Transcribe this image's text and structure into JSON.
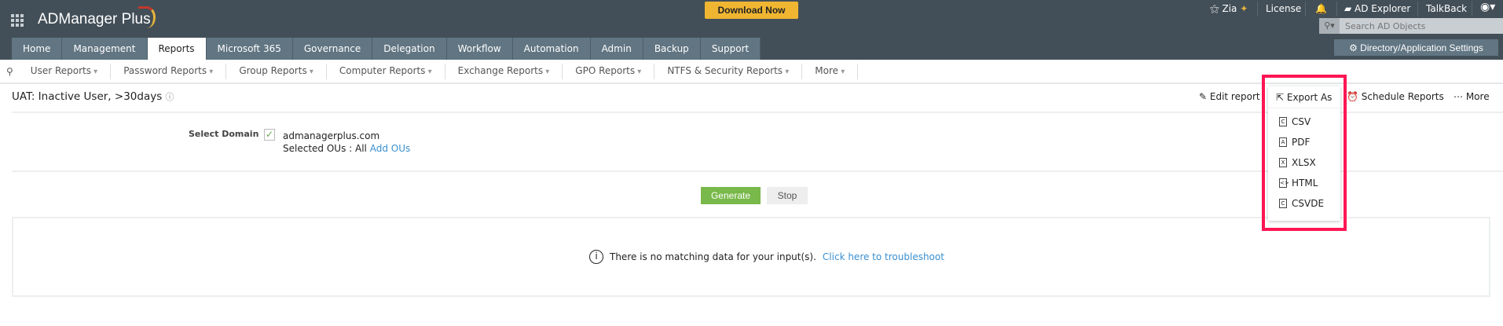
{
  "header": {
    "app_name": "ADManager Plus",
    "download": "Download Now",
    "zia": "Zia",
    "license": "License",
    "ad_explorer": "AD Explorer",
    "talkback": "TalkBack",
    "search_placeholder": "Search AD Objects",
    "settings": "Directory/Application Settings"
  },
  "tabs": [
    "Home",
    "Management",
    "Reports",
    "Microsoft 365",
    "Governance",
    "Delegation",
    "Workflow",
    "Automation",
    "Admin",
    "Backup",
    "Support"
  ],
  "active_tab": "Reports",
  "subnav": [
    "User Reports",
    "Password Reports",
    "Group Reports",
    "Computer Reports",
    "Exchange Reports",
    "GPO Reports",
    "NTFS & Security Reports",
    "More"
  ],
  "page": {
    "title": "UAT: Inactive User, >30days",
    "edit": "Edit report",
    "export": "Export As",
    "schedule": "Schedule Reports",
    "more": "More"
  },
  "export_menu": [
    {
      "label": "CSV",
      "glyph": "C"
    },
    {
      "label": "PDF",
      "glyph": "A"
    },
    {
      "label": "XLSX",
      "glyph": "X"
    },
    {
      "label": "HTML",
      "glyph": "<>"
    },
    {
      "label": "CSVDE",
      "glyph": "C"
    }
  ],
  "form": {
    "select_domain": "Select Domain",
    "domain": "admanagerplus.com",
    "ous_label": "Selected OUs :",
    "ous_value": "All",
    "add_ous": "Add OUs",
    "generate": "Generate",
    "stop": "Stop"
  },
  "result": {
    "message": "There is no matching data for your input(s).",
    "link": "Click here to troubleshoot"
  },
  "colors": {
    "header": "#434f58",
    "tab": "#617582",
    "highlight": "#ff1654",
    "generate": "#79b84a",
    "link": "#3a8fd0"
  }
}
